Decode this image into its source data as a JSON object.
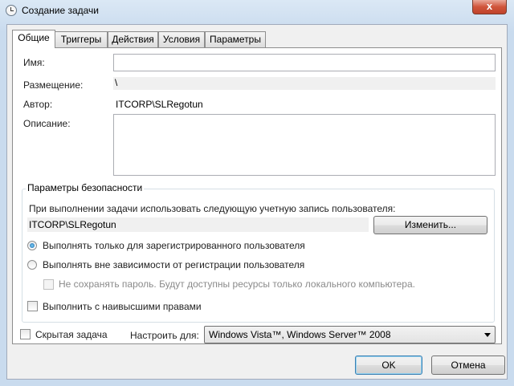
{
  "window": {
    "title": "Создание задачи",
    "close_glyph": "x"
  },
  "tabs": [
    {
      "label": "Общие",
      "active": true
    },
    {
      "label": "Триггеры",
      "active": false
    },
    {
      "label": "Действия",
      "active": false
    },
    {
      "label": "Условия",
      "active": false
    },
    {
      "label": "Параметры",
      "active": false
    }
  ],
  "general": {
    "name_label": "Имя:",
    "name_value": "",
    "location_label": "Размещение:",
    "location_value": "\\",
    "author_label": "Автор:",
    "author_value": "ITCORP\\SLRegotun",
    "description_label": "Описание:",
    "description_value": ""
  },
  "security": {
    "group_title": "Параметры безопасности",
    "run_as_label": "При выполнении задачи использовать следующую учетную запись пользователя:",
    "account_value": "ITCORP\\SLRegotun",
    "change_button": "Изменить...",
    "radio_logged_on": {
      "label": "Выполнять только для зарегистрированного пользователя",
      "selected": true
    },
    "radio_any": {
      "label": "Выполнять вне зависимости от регистрации пользователя",
      "selected": false
    },
    "no_store_password": {
      "label": "Не сохранять пароль. Будут доступны ресурсы только локального компьютера.",
      "checked": false,
      "enabled": false
    },
    "highest_privileges": {
      "label": "Выполнить с наивысшими правами",
      "checked": false
    }
  },
  "bottom": {
    "hidden_label": "Скрытая задача",
    "hidden_checked": false,
    "configure_label": "Настроить для:",
    "configure_value": "Windows Vista™, Windows Server™ 2008"
  },
  "dialog_buttons": {
    "ok": "OK",
    "cancel": "Отмена"
  }
}
